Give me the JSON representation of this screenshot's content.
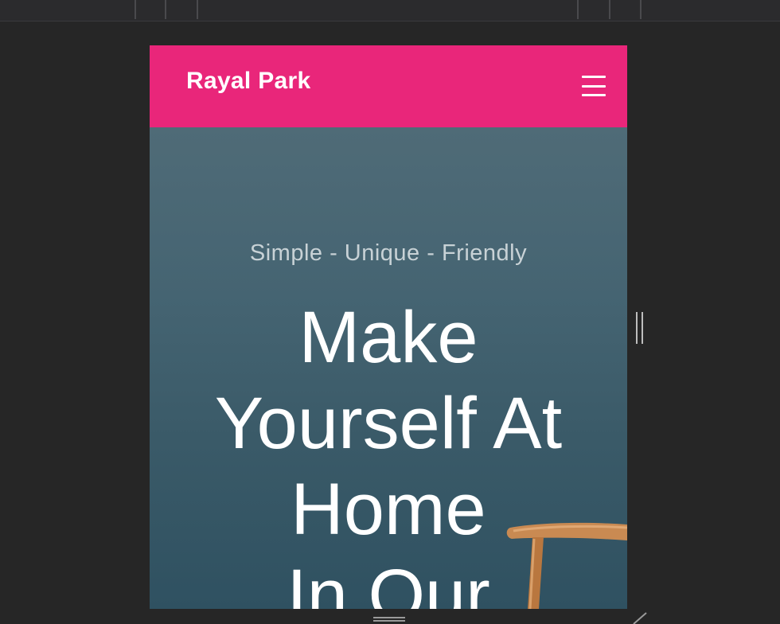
{
  "navbar": {
    "brand": "Rayal Park",
    "menu_icon": "hamburger-menu-icon"
  },
  "hero": {
    "subtitle": "Simple - Unique - Friendly",
    "title_lines": [
      "Make",
      "Yourself At",
      "Home",
      "In Our"
    ],
    "decor_icon": "wooden-chair"
  },
  "colors": {
    "navbar_bg": "#e9267a",
    "hero_bg": "#3f5f6d",
    "page_bg": "#262626"
  }
}
